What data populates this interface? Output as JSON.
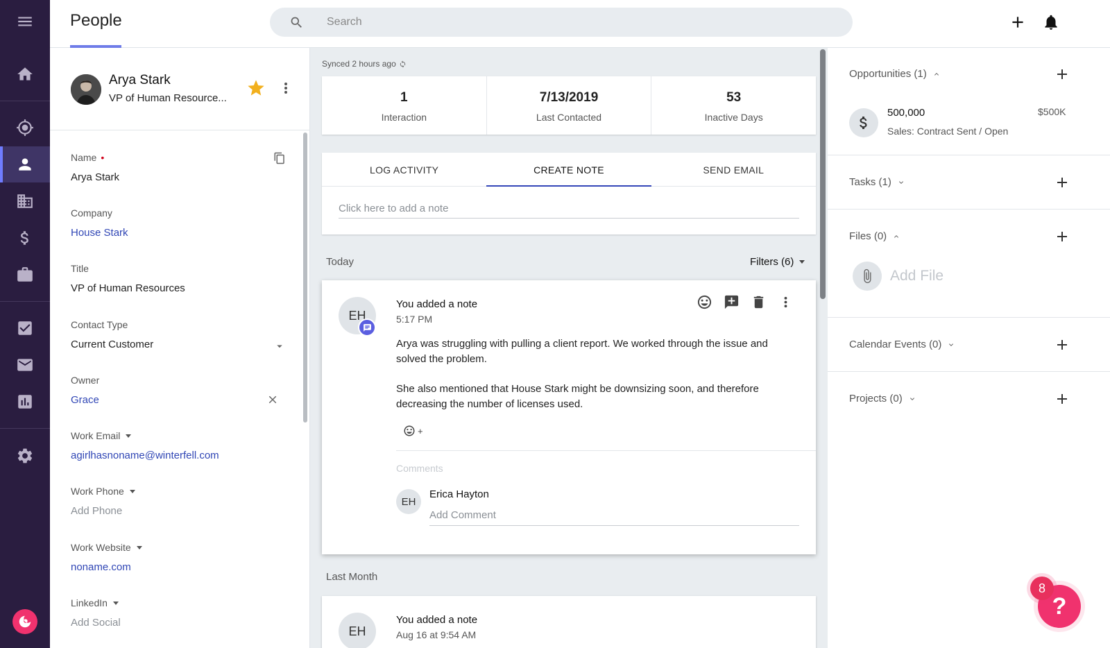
{
  "header": {
    "title": "People",
    "search_placeholder": "Search"
  },
  "profile": {
    "name": "Arya Stark",
    "title": "VP of Human Resource...",
    "fields": {
      "name": {
        "label": "Name",
        "value": "Arya Stark"
      },
      "company": {
        "label": "Company",
        "value": "House Stark"
      },
      "title": {
        "label": "Title",
        "value": "VP of Human Resources"
      },
      "contact_type": {
        "label": "Contact Type",
        "value": "Current Customer"
      },
      "owner": {
        "label": "Owner",
        "value": "Grace"
      },
      "work_email": {
        "label": "Work Email",
        "value": "agirlhasnoname@winterfell.com"
      },
      "work_phone": {
        "label": "Work Phone",
        "value": "Add Phone"
      },
      "work_website": {
        "label": "Work Website",
        "value": "noname.com"
      },
      "linkedin": {
        "label": "LinkedIn",
        "value": "Add Social"
      }
    }
  },
  "feed": {
    "synced": "Synced 2 hours ago",
    "stats": [
      {
        "value": "1",
        "label": "Interaction"
      },
      {
        "value": "7/13/2019",
        "label": "Last Contacted"
      },
      {
        "value": "53",
        "label": "Inactive Days"
      }
    ],
    "tabs": [
      "LOG ACTIVITY",
      "CREATE NOTE",
      "SEND EMAIL"
    ],
    "note_placeholder": "Click here to add a note",
    "today_label": "Today",
    "filters_label": "Filters (6)",
    "note": {
      "initials": "EH",
      "heading": "You added a note",
      "time": "5:17 PM",
      "paragraph1": "Arya was struggling with pulling a client report. We worked through the issue and solved the problem.",
      "paragraph2": "She also mentioned that House Stark might be downsizing soon, and therefore decreasing the number of licenses used.",
      "react_plus": "+",
      "comments_label": "Comments",
      "commenter_initials": "EH",
      "commenter_name": "Erica Hayton",
      "comment_placeholder": "Add Comment"
    },
    "last_month_label": "Last Month",
    "note2": {
      "initials": "EH",
      "heading": "You added a note",
      "time": "Aug 16 at 9:54 AM"
    }
  },
  "right": {
    "opportunities_title": "Opportunities (1)",
    "opportunity": {
      "amount": "500,000",
      "stage": "Sales: Contract Sent / Open",
      "short_amount": "$500K"
    },
    "tasks_title": "Tasks (1)",
    "files_title": "Files (0)",
    "add_file": "Add File",
    "calendar_title": "Calendar Events (0)",
    "projects_title": "Projects (0)"
  },
  "help": {
    "badge_count": "8",
    "glyph": "?"
  },
  "colors": {
    "rail": "#2a1d40",
    "accent": "#3346b8",
    "link": "#3046b5",
    "brand": "#f0326e",
    "star": "#f2b01e"
  }
}
